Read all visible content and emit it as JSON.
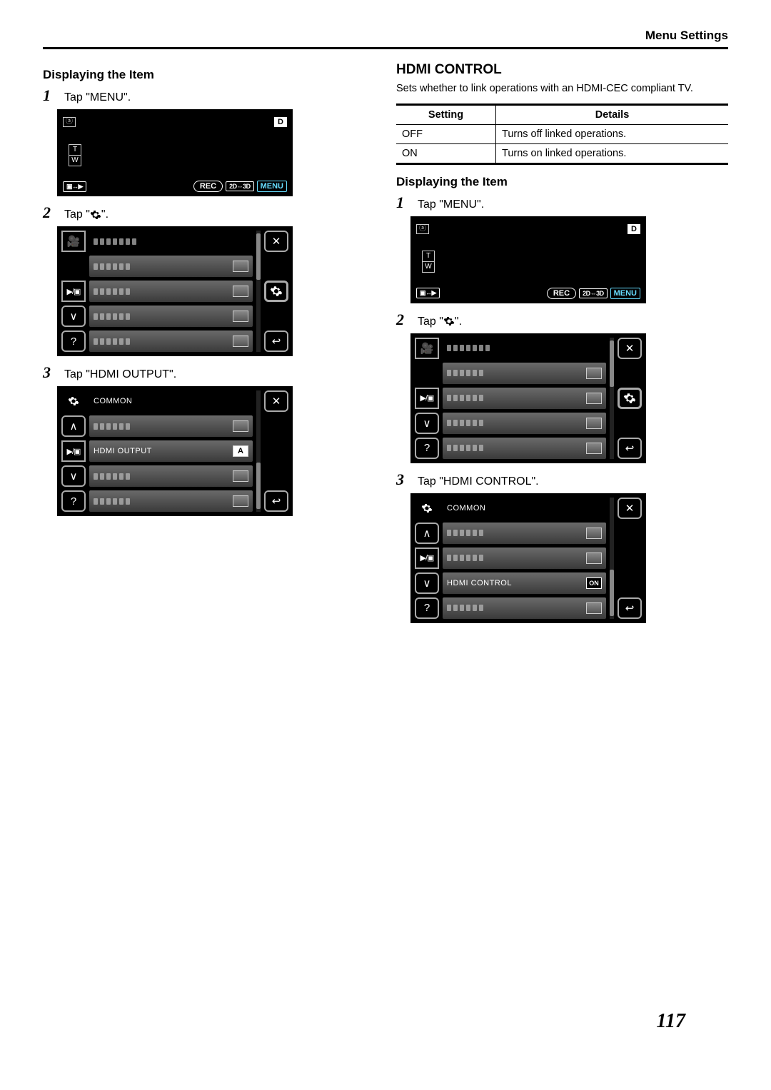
{
  "header": {
    "title": "Menu Settings"
  },
  "page_number": "117",
  "gear_char": "✿",
  "left": {
    "displaying_heading": "Displaying the Item",
    "steps": {
      "1": {
        "num": "1",
        "text_pre": "Tap \"",
        "menu_word": "MENU",
        "text_post": "\"."
      },
      "2": {
        "num": "2",
        "text_pre": "Tap \"",
        "text_post": "\"."
      },
      "3": {
        "num": "3",
        "text_pre": "Tap \"",
        "target": "HDMI OUTPUT",
        "text_post": "\"."
      }
    }
  },
  "right": {
    "hdmi_control_heading": "HDMI CONTROL",
    "hdmi_control_desc": "Sets whether to link operations with an HDMI-CEC compliant TV.",
    "table": {
      "head_setting": "Setting",
      "head_details": "Details",
      "rows": [
        {
          "setting": "OFF",
          "details": "Turns off linked operations."
        },
        {
          "setting": "ON",
          "details": "Turns on linked operations."
        }
      ]
    },
    "displaying_heading": "Displaying the Item",
    "steps": {
      "1": {
        "num": "1",
        "text_pre": "Tap \"",
        "menu_word": "MENU",
        "text_post": "\"."
      },
      "2": {
        "num": "2",
        "text_pre": "Tap \"",
        "text_post": "\"."
      },
      "3": {
        "num": "3",
        "text_pre": "Tap \"",
        "target": "HDMI CONTROL",
        "text_post": "\"."
      }
    }
  },
  "lcd_rec": {
    "t": "T",
    "w": "W",
    "d": "D",
    "rec": "REC",
    "mode2d3d": "2D⇔3D",
    "menu": "MENU"
  },
  "lcd_menu": {
    "close": "✕",
    "back": "↩",
    "help": "?",
    "up": "∧",
    "down": "∨",
    "tab_play_rec": "▶/▣"
  },
  "lcd_common_left": {
    "title": "COMMON",
    "highlight_label": "HDMI OUTPUT",
    "highlight_badge": "A"
  },
  "lcd_common_right": {
    "title": "COMMON",
    "highlight_label": "HDMI CONTROL",
    "highlight_badge": "ON"
  }
}
